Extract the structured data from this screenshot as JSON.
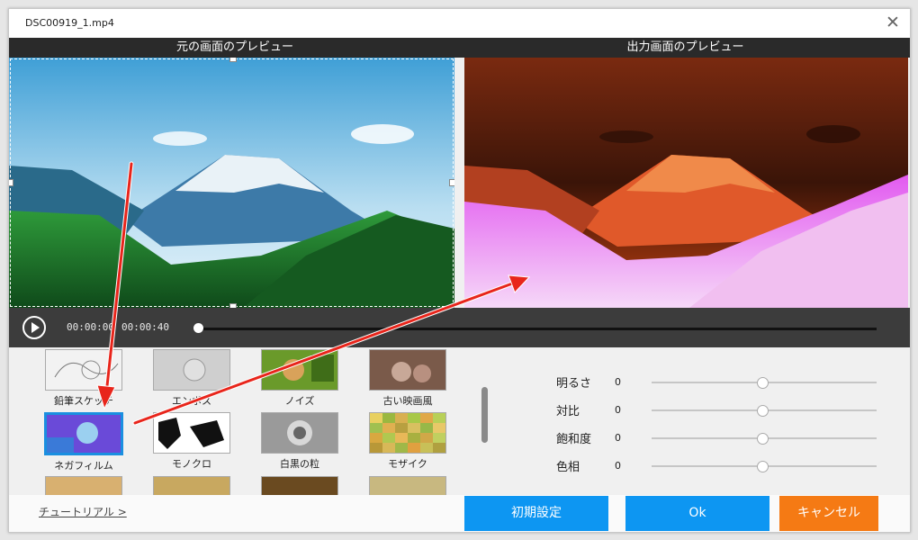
{
  "window": {
    "title": "DSC00919_1.mp4"
  },
  "preview": {
    "original_title": "元の画面のプレビュー",
    "output_title": "出力画面のプレビュー"
  },
  "player": {
    "current_time": "00:00:00",
    "total_time": "00:00:40",
    "progress": 0.0
  },
  "filters": [
    {
      "label": "鉛筆スケッチ",
      "icon": "pencil-sketch-thumb"
    },
    {
      "label": "エンボス",
      "icon": "emboss-thumb"
    },
    {
      "label": "ノイズ",
      "icon": "noise-thumb"
    },
    {
      "label": "古い映画風",
      "icon": "old-film-thumb"
    },
    {
      "label": "ネガフィルム",
      "icon": "negative-film-thumb",
      "selected": true
    },
    {
      "label": "モノクロ",
      "icon": "monochrome-thumb"
    },
    {
      "label": "白黒の粒",
      "icon": "bw-grain-thumb"
    },
    {
      "label": "モザイク",
      "icon": "mosaic-thumb"
    }
  ],
  "adjustments": [
    {
      "label": "明るさ",
      "value": "0"
    },
    {
      "label": "対比",
      "value": "0"
    },
    {
      "label": "飽和度",
      "value": "0"
    },
    {
      "label": "色相",
      "value": "0"
    }
  ],
  "footer": {
    "tutorial_link": "チュートリアル >",
    "reset_label": "初期設定",
    "ok_label": "Ok",
    "cancel_label": "キャンセル"
  },
  "colors": {
    "accent": "#0d96f2",
    "cancel": "#f57a14",
    "annotation_arrow": "#e8251b"
  }
}
